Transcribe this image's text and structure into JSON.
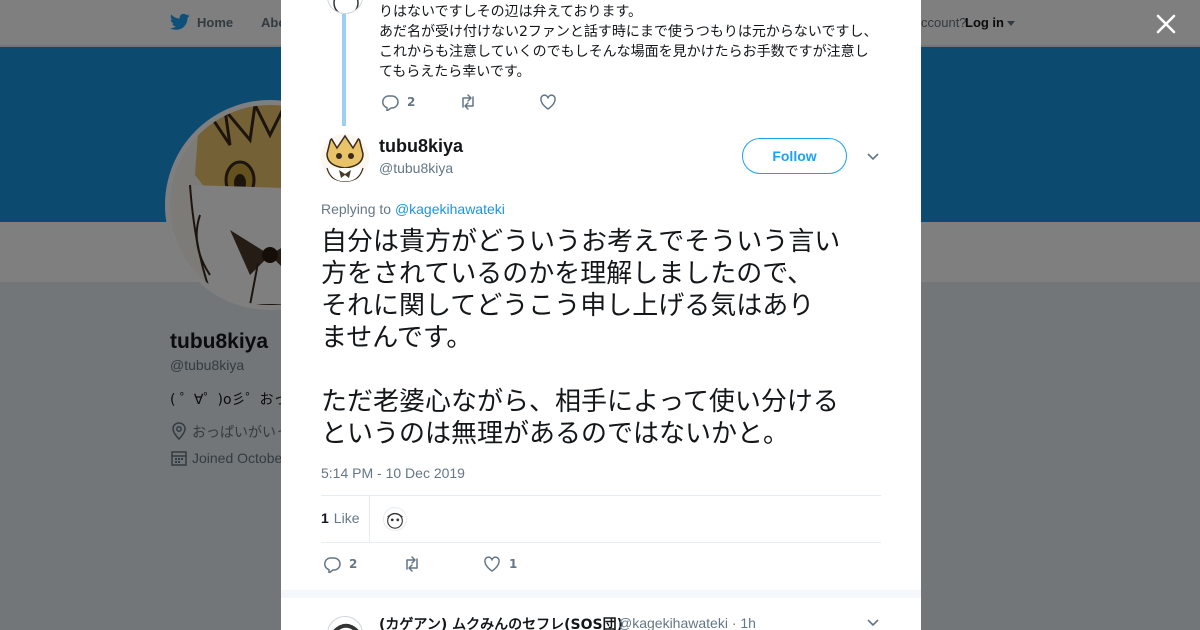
{
  "nav": {
    "home_label": "Home",
    "about_label": "Abo",
    "account_prompt": "ccount?",
    "login_label": "Log in"
  },
  "profile": {
    "name": "tubu8kiya",
    "handle": "@tubu8kiya",
    "bio": "( ゜∀゜)o彡゜おっぱ",
    "location": "おっぱいがいっ",
    "joined": "Joined Octobe"
  },
  "previous_tweet": {
    "lines": [
      "りはないですしその辺は弁えております。",
      "あだ名が受け付けない2ファンと話す時にまで使うつもりは元からないですし、",
      "これからも注意していくのでもしそんな場面を見かけたらお手数ですが注意し",
      "てもらえたら幸いです。"
    ],
    "reply_count": "2",
    "retweet_count": "",
    "like_count": ""
  },
  "tweet": {
    "author_name": "tubu8kiya",
    "author_handle": "@tubu8kiya",
    "follow_label": "Follow",
    "replying_prefix": "Replying to",
    "replying_handle": "@kagekihawateki",
    "paragraph1": [
      "自分は貴方がどういうお考えでそういう言い",
      "方をされているのかを理解しましたので、",
      "それに関してどうこう申し上げる気はあり",
      "ませんです。"
    ],
    "paragraph2": [
      "ただ老婆心ながら、相手によって使い分ける",
      "というのは無理があるのではないかと。"
    ],
    "timestamp": "5:14 PM - 10 Dec 2019",
    "likes_count": "1",
    "likes_label": "Like",
    "reply_count": "2",
    "retweet_count": "",
    "like_count": "1"
  },
  "next_tweet": {
    "author_name": "(カゲアン) ムクみんのセフレ(SOS団)",
    "author_handle": "@kagekihawateki",
    "time": "· 1h"
  },
  "colors": {
    "brand_blue": "#1da1f2",
    "banner": "#1b95e0",
    "thread_line": "#9bd0f2"
  },
  "icons": [
    "twitter-bird-icon",
    "close-icon",
    "reply-icon",
    "retweet-icon",
    "heart-icon",
    "chevron-down-icon",
    "location-icon",
    "calendar-icon"
  ]
}
